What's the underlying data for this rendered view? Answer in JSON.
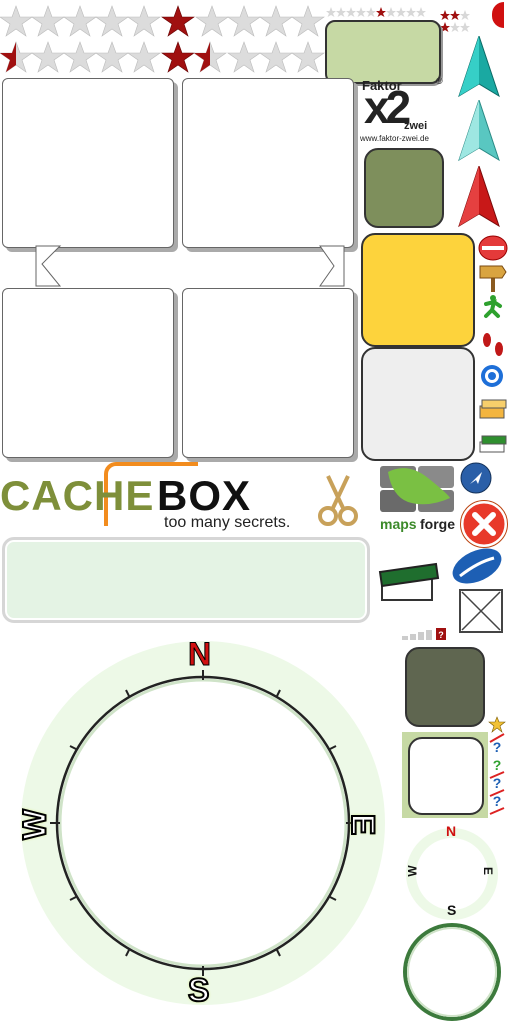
{
  "logo_cachebox": {
    "word_left": "CACHE",
    "word_right": "BOX",
    "tagline": "too many secrets."
  },
  "logo_faktor": {
    "line1": "Faktor",
    "big": "x2",
    "line2": "zwei",
    "url": "www.faktor-zwei.de",
    "registered": "®"
  },
  "logo_mapsforge": {
    "text_left": "maps",
    "text_right": "forge"
  },
  "compass_big": {
    "n": "N",
    "e": "E",
    "s": "S",
    "w": "W"
  },
  "compass_small": {
    "n": "N",
    "e": "E",
    "s": "S",
    "w": "W"
  },
  "colors": {
    "star_filled": "#a01010",
    "star_empty": "#d8d8d8",
    "panel_green": "#c6d9a4",
    "tile_olive": "#7e8f5c",
    "tile_yellow": "#fdd33c",
    "tile_grey": "#eeeeee",
    "tile_dark": "#5f6650",
    "input_green": "#e4f3e4",
    "compass_ring": "#edf9e7"
  },
  "icons": [
    "red-star-icon",
    "arrow-teal-icon",
    "arrow-red-icon",
    "stop-icon",
    "signpost-icon",
    "runner-icon",
    "footprints-icon",
    "target-icon",
    "cache-box-icon",
    "scissors-icon",
    "close-icon",
    "navigation-icon",
    "ruler-icon",
    "checkbox-icon",
    "signal-icon",
    "question-icon"
  ]
}
